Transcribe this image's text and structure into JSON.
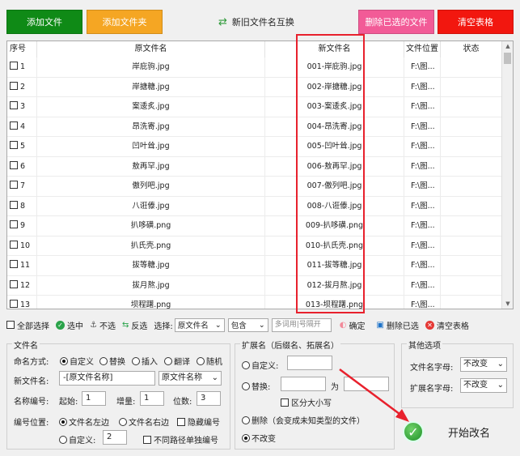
{
  "toolbar": {
    "add_file": "添加文件",
    "add_folder": "添加文件夹",
    "swap": "新旧文件名互换",
    "delete_selected": "删除已选的文件",
    "clear_table": "清空表格"
  },
  "table": {
    "headers": [
      "序号",
      "原文件名",
      "新文件名",
      "文件位置",
      "状态"
    ],
    "rows": [
      {
        "idx": "1",
        "orig": "岸庇驹.jpg",
        "new": "001-岸庇驹.jpg",
        "loc": "F:\\图..."
      },
      {
        "idx": "2",
        "orig": "岸搪糖.jpg",
        "new": "002-岸搪糖.jpg",
        "loc": "F:\\图..."
      },
      {
        "idx": "3",
        "orig": "案逶炙.jpg",
        "new": "003-案逶炙.jpg",
        "loc": "F:\\图..."
      },
      {
        "idx": "4",
        "orig": "昂洗寄.jpg",
        "new": "004-昂洗寄.jpg",
        "loc": "F:\\图..."
      },
      {
        "idx": "5",
        "orig": "凹叶耸.jpg",
        "new": "005-凹叶耸.jpg",
        "loc": "F:\\图..."
      },
      {
        "idx": "6",
        "orig": "敖再罕.jpg",
        "new": "006-敖再罕.jpg",
        "loc": "F:\\图..."
      },
      {
        "idx": "7",
        "orig": "傲列吧.jpg",
        "new": "007-傲列吧.jpg",
        "loc": "F:\\图..."
      },
      {
        "idx": "8",
        "orig": "八诳傣.jpg",
        "new": "008-八诳傣.jpg",
        "loc": "F:\\图..."
      },
      {
        "idx": "9",
        "orig": "扒哆磺.png",
        "new": "009-扒哆磺.png",
        "loc": "F:\\图..."
      },
      {
        "idx": "10",
        "orig": "扒氏壳.png",
        "new": "010-扒氏壳.png",
        "loc": "F:\\图..."
      },
      {
        "idx": "11",
        "orig": "拔等糖.jpg",
        "new": "011-拔等糖.jpg",
        "loc": "F:\\图..."
      },
      {
        "idx": "12",
        "orig": "拔月熬.jpg",
        "new": "012-拔月熬.jpg",
        "loc": "F:\\图..."
      },
      {
        "idx": "13",
        "orig": "坝程躇.png",
        "new": "013-坝程躇.png",
        "loc": "F:\\图..."
      }
    ]
  },
  "select_bar": {
    "select_all": "全部选择",
    "select": "选中",
    "unselect": "不选",
    "invert": "反选",
    "select_label": "选择:",
    "field_value": "原文件名",
    "mode_value": "包含",
    "input_placeholder": "多词用|号隔开",
    "confirm": "确定",
    "delete_selected": "删除已选",
    "clear_table": "清空表格"
  },
  "filename_group": {
    "title": "文件名",
    "naming_label": "命名方式:",
    "modes": [
      "自定义",
      "替换",
      "插入",
      "翻译",
      "随机"
    ],
    "new_name_label": "新文件名:",
    "new_name_value": "-[原文件名称]",
    "new_name_dropdown": "原文件名称",
    "numbering_label": "名称编号:",
    "start_label": "起始:",
    "start_value": "1",
    "step_label": "增量:",
    "step_value": "1",
    "digits_label": "位数:",
    "digits_value": "3",
    "position_label": "编号位置:",
    "pos_left": "文件名左边",
    "pos_right": "文件名右边",
    "hide_number": "隐藏编号",
    "pos_custom": "自定义:",
    "pos_custom_value": "2",
    "separate_path": "不同路径单独编号"
  },
  "ext_group": {
    "title": "扩展名（后缀名、拓展名）",
    "custom": "自定义:",
    "replace": "替换:",
    "to": "为",
    "case": "区分大小写",
    "delete": "删除（会变成未知类型的文件）",
    "no_change": "不改变"
  },
  "other_group": {
    "title": "其他选项",
    "filename_case_label": "文件名字母:",
    "filename_case_value": "不改变",
    "ext_case_label": "扩展名字母:",
    "ext_case_value": "不改变"
  },
  "start_button": "开始改名",
  "colors": {
    "add_file": "#0f8a16",
    "add_folder": "#f5a623",
    "delete_selected": "#f25b97",
    "clear_table": "#f2170f",
    "highlight": "#e8212d"
  }
}
